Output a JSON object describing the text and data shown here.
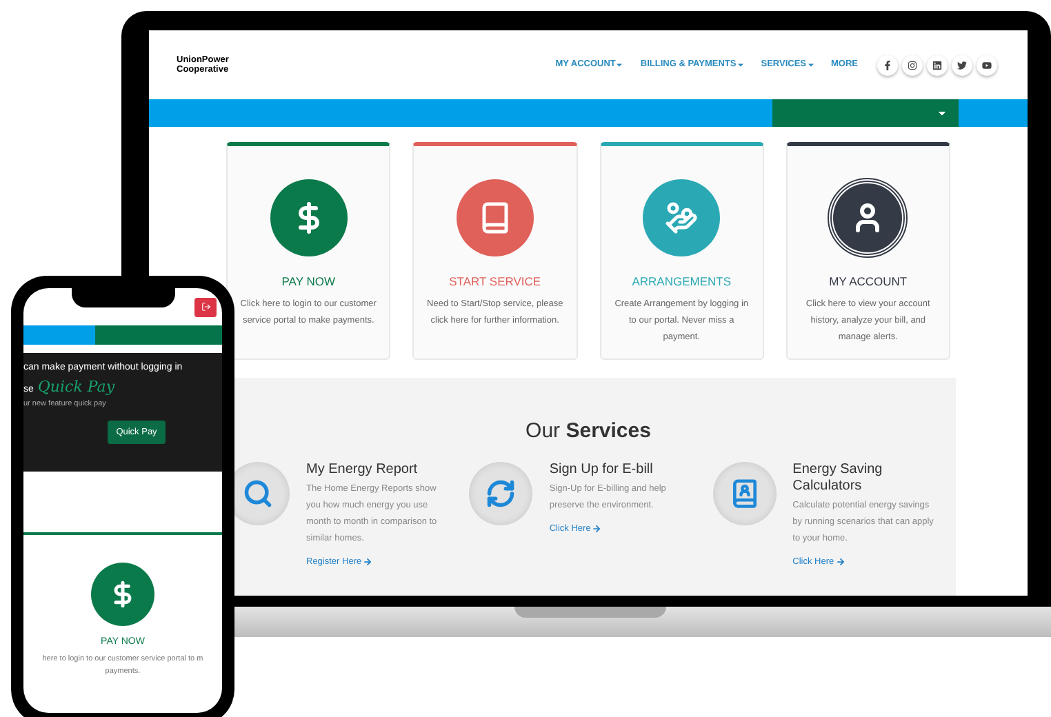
{
  "laptop": {
    "header": {
      "logo": {
        "line_1": "UnionPower",
        "line_2": "Cooperative"
      },
      "nav": [
        {
          "label": "MY ACCOUNT",
          "dropdown": true
        },
        {
          "label": "BILLING & PAYMENTS",
          "dropdown": true
        },
        {
          "label": "SERVICES",
          "dropdown": true
        },
        {
          "label": "MORE",
          "dropdown": false
        }
      ]
    },
    "cards": [
      {
        "kind": "dollar",
        "title": "PAY NOW",
        "description": "Click here to login to our customer service portal to make payments.",
        "color": "#0b7a4b"
      },
      {
        "kind": "book",
        "title": "START SERVICE",
        "description": "Need to Start/Stop service, please click here for further information.",
        "color": "#e0605a"
      },
      {
        "kind": "hand",
        "title": "ARRANGEMENTS",
        "description": "Create Arrangement by logging in to our portal. Never miss a payment.",
        "color": "#2aa9b4"
      },
      {
        "kind": "user",
        "title": "MY ACCOUNT",
        "description": "Click here to view your account history, analyze your bill, and manage alerts.",
        "color": "#343a46"
      }
    ],
    "services": {
      "title": "Our **Services**",
      "items": [
        {
          "kind": "search",
          "title": "My Energy Report",
          "description": "The Home Energy Reports show you how much energy you use month to month in comparison to similar homes.",
          "link": "Register Here"
        },
        {
          "kind": "cycle",
          "title": "Sign Up for E-bill",
          "description": "Sign-Up for E-billing and help preserve the environment.",
          "link": "Click Here"
        },
        {
          "kind": "contacts",
          "title": "Energy Saving Calculators",
          "description": "Calculate potential energy savings by running scenarios that can apply to your home.",
          "link": "Click Here"
        }
      ]
    }
  },
  "phone": {
    "banner": {
      "line_1": "can make payment without logging in",
      "prefix": "se",
      "highlight": "Quick Pay",
      "subtitle": "ur new feature quick pay",
      "button": "Quick Pay"
    },
    "card": {
      "kind": "dollar",
      "title": "PAY NOW",
      "description_lines": [
        "here to login to our customer service portal to m",
        "payments."
      ],
      "color": "#0b7a4b"
    }
  }
}
